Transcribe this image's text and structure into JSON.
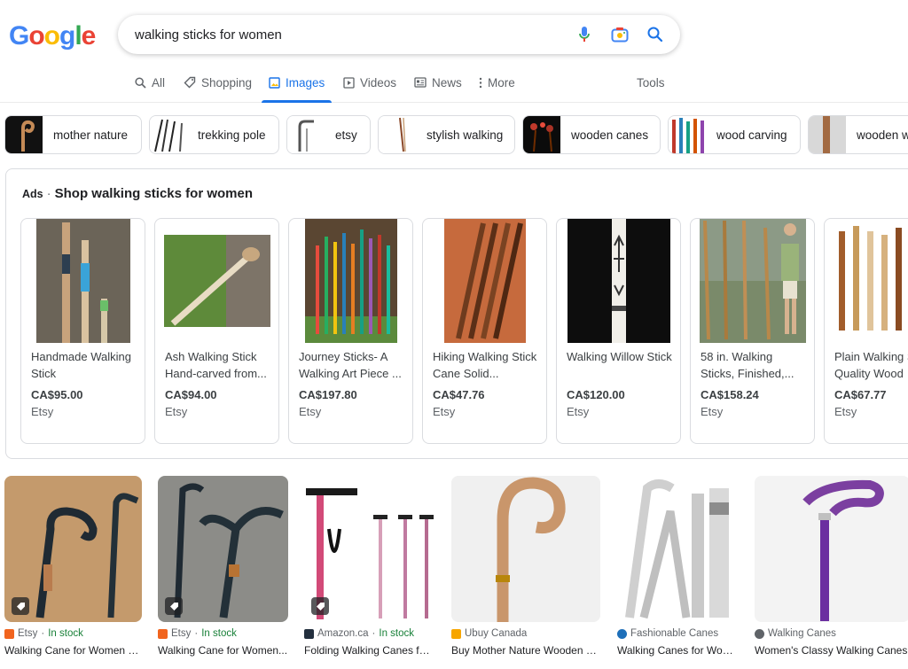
{
  "search": {
    "query": "walking sticks for women"
  },
  "tabs": [
    {
      "label": "All",
      "icon": "search-icon"
    },
    {
      "label": "Shopping",
      "icon": "tag-icon"
    },
    {
      "label": "Images",
      "icon": "image-icon",
      "active": true
    },
    {
      "label": "Videos",
      "icon": "play-icon"
    },
    {
      "label": "News",
      "icon": "news-icon"
    },
    {
      "label": "More",
      "icon": "more-vert-icon"
    }
  ],
  "tools_label": "Tools",
  "chips": [
    {
      "label": "mother nature"
    },
    {
      "label": "trekking pole"
    },
    {
      "label": "etsy"
    },
    {
      "label": "stylish walking"
    },
    {
      "label": "wooden canes"
    },
    {
      "label": "wood carving"
    },
    {
      "label": "wooden w"
    }
  ],
  "ads": {
    "tag": "Ads",
    "sep": "·",
    "heading": "Shop walking sticks for women",
    "products": [
      {
        "title": "Handmade Walking Stick",
        "price": "CA$95.00",
        "store": "Etsy"
      },
      {
        "title": "Ash Walking Stick Hand-carved from...",
        "price": "CA$94.00",
        "store": "Etsy"
      },
      {
        "title": "Journey Sticks- A Walking Art Piece ...",
        "price": "CA$197.80",
        "store": "Etsy"
      },
      {
        "title": "Hiking Walking Stick Cane Solid...",
        "price": "CA$47.76",
        "store": "Etsy"
      },
      {
        "title": "Walking Willow Stick",
        "price": "CA$120.00",
        "store": "Etsy"
      },
      {
        "title": "58 in. Walking Sticks, Finished,...",
        "price": "CA$158.24",
        "store": "Etsy"
      },
      {
        "title": "Plain Walking S + Quality Wood",
        "price": "CA$67.77",
        "store": "Etsy"
      }
    ]
  },
  "results": [
    {
      "source": "Etsy",
      "stock": "In stock",
      "title": "Walking Cane for Women W...",
      "favicon_color": "#f1641e"
    },
    {
      "source": "Etsy",
      "stock": "In stock",
      "title": "Walking Cane for Women...",
      "favicon_color": "#f1641e"
    },
    {
      "source": "Amazon.ca",
      "stock": "In stock",
      "title": "Folding Walking Canes for...",
      "favicon_color": "#232f3e"
    },
    {
      "source": "Ubuy Canada",
      "stock": "",
      "title": "Buy Mother Nature Wooden W...",
      "favicon_color": "#f7a600"
    },
    {
      "source": "Fashionable Canes",
      "stock": "",
      "title": "Walking Canes for Wom...",
      "favicon_color": "#1e6fb9"
    },
    {
      "source": "Walking Canes",
      "stock": "",
      "title": "Women's Classy Walking Canes",
      "favicon_color": "#5f6368"
    }
  ],
  "colors": {
    "accent": "#1a73e8",
    "in_stock": "#188038"
  }
}
